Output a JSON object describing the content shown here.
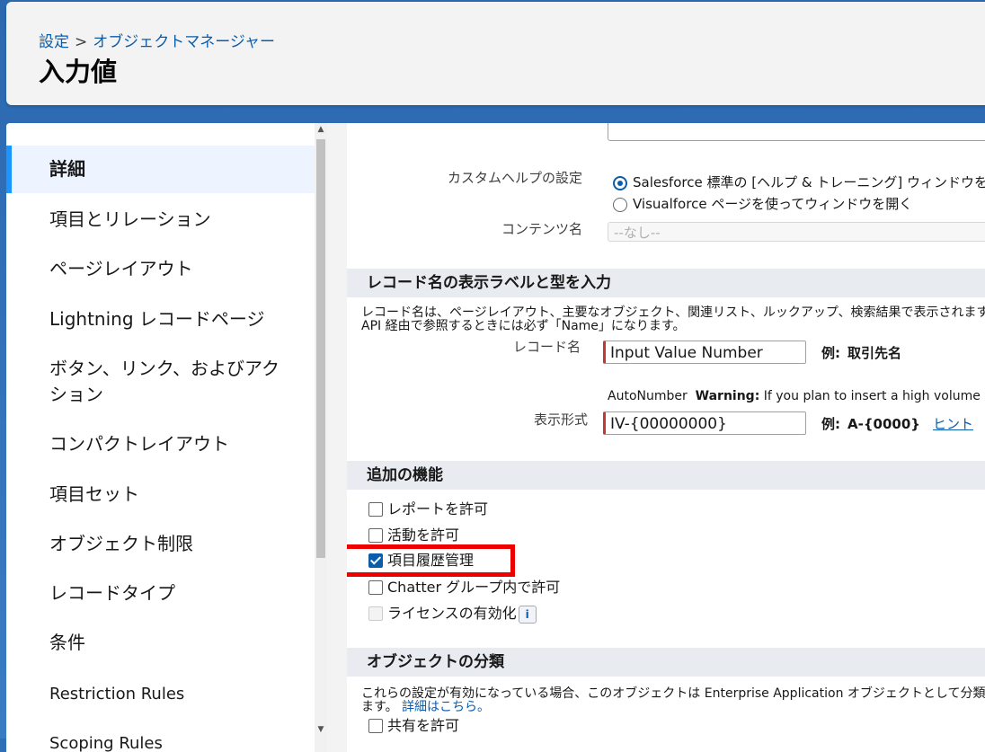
{
  "header": {
    "breadcrumb": {
      "setup": "設定",
      "separator": ">",
      "object_manager": "オブジェクトマネージャー"
    },
    "title": "入力値"
  },
  "sidebar": {
    "items": [
      {
        "label": "詳細",
        "active": true
      },
      {
        "label": "項目とリレーション"
      },
      {
        "label": "ページレイアウト"
      },
      {
        "label": "Lightning レコードページ"
      },
      {
        "label": "ボタン、リンク、およびアク\nション"
      },
      {
        "label": "コンパクトレイアウト"
      },
      {
        "label": "項目セット"
      },
      {
        "label": "オブジェクト制限"
      },
      {
        "label": "レコードタイプ"
      },
      {
        "label": "条件"
      },
      {
        "label": "Restriction Rules"
      },
      {
        "label": "Scoping Rules"
      }
    ]
  },
  "custom_help": {
    "label": "カスタムヘルプの設定",
    "option1": "Salesforce 標準の [ヘルプ & トレーニング] ウィンドウを開く",
    "option2": "Visualforce ページを使ってウィンドウを開く",
    "content_label": "コンテンツ名",
    "content_value": "--なし--"
  },
  "record_name_section": {
    "title": "レコード名の表示ラベルと型を入力",
    "desc_line1": "レコード名は、ページレイアウト、主要なオブジェクト、関連リスト、ルックアップ、検索結果で表示されます。た",
    "desc_line2": "API 経由で参照するときには必ず「Name」になります。",
    "record_name_label": "レコード名",
    "record_name_value": "Input Value Number",
    "example_label": "例:",
    "record_name_example": "取引先名",
    "autonumber_text": "AutoNumber",
    "warning_label": "Warning:",
    "warning_text": "If you plan to insert a high volume",
    "display_format_label": "表示形式",
    "display_format_value": "IV-{00000000}",
    "display_format_example": "A-{0000}",
    "hint_link": "ヒント"
  },
  "additional_features": {
    "title": "追加の機能",
    "checkboxes": [
      {
        "label": "レポートを許可",
        "checked": false
      },
      {
        "label": "活動を許可",
        "checked": false
      },
      {
        "label": "項目履歴管理",
        "checked": true
      },
      {
        "label": "Chatter グループ内で許可",
        "checked": false
      },
      {
        "label": "ライセンスの有効化",
        "checked": false,
        "disabled": true
      }
    ],
    "info_icon": "i"
  },
  "object_classification": {
    "title": "オブジェクトの分類",
    "desc_line1": "これらの設定が有効になっている場合、このオブジェクトは Enterprise Application オブジェクトとして分類さ",
    "desc_line2_prefix": "ます。",
    "desc_link": "詳細はこちら。",
    "checkbox_label": "共有を許可"
  },
  "colors": {
    "link": "#0b5cab",
    "required_bar": "#c23934",
    "highlight": "#ee0000",
    "active_nav_border": "#1b96ff"
  }
}
